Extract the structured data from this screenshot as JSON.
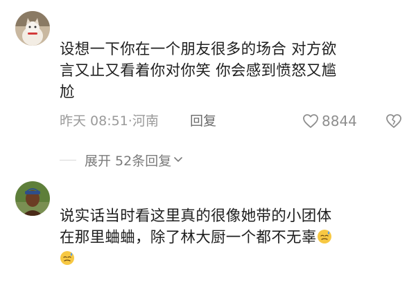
{
  "comments": [
    {
      "text_lines": [
        "设想一下你在一个朋友很多的场合 对方欲",
        "言又止又看着你对你笑 你会感到愤怒又尴",
        "尬"
      ],
      "time_location": "昨天 08:51·河南",
      "reply_label": "回复",
      "like_count": "8844",
      "expand_label": "展开 52条回复"
    },
    {
      "text_lines": [
        "说实话当时看这里真的很像她带的小团体",
        "在那里蛐蛐，除了林大厨一个都不无辜"
      ],
      "emoji": "sweat-smile-emoji"
    }
  ],
  "colors": {
    "text": "#1e1e1e",
    "meta": "#9a9a9a",
    "reply": "#6b6b6b",
    "divider": "#d6d6d6"
  }
}
